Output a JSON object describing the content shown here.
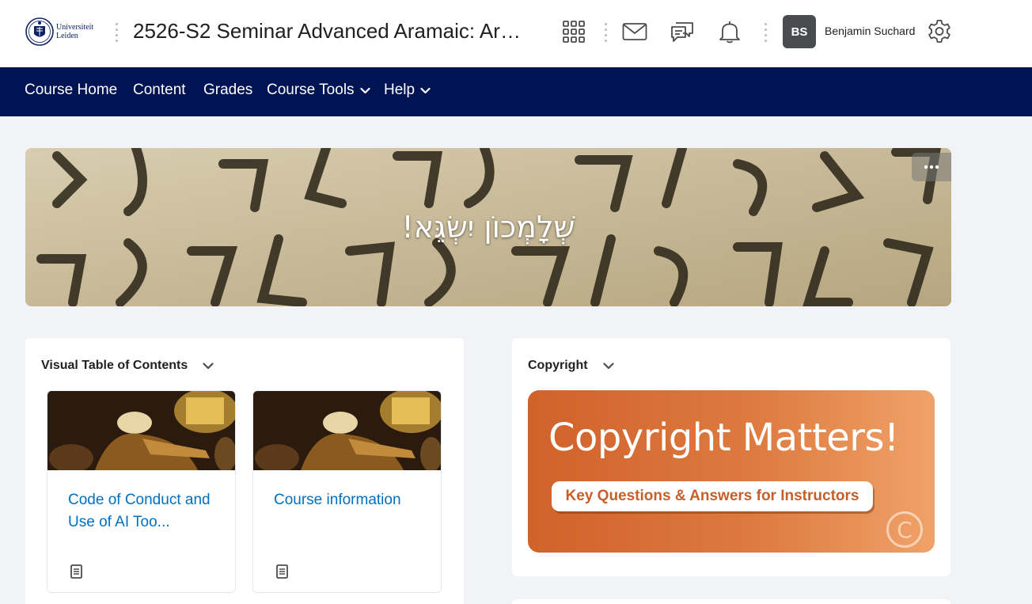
{
  "header": {
    "logo_text": [
      "Universiteit",
      "Leiden"
    ],
    "course_title": "2526-S2 Seminar Advanced Aramaic: Aram...",
    "icons": [
      "waffle-icon",
      "mail-icon",
      "chat-icon",
      "bell-icon",
      "gear-icon"
    ],
    "user": {
      "initials": "BS",
      "name": "Benjamin Suchard"
    }
  },
  "nav": {
    "items": [
      {
        "label": "Course Home",
        "dropdown": false
      },
      {
        "label": "Content",
        "dropdown": false
      },
      {
        "label": "Grades",
        "dropdown": false
      },
      {
        "label": "Course Tools",
        "dropdown": true
      },
      {
        "label": "Help",
        "dropdown": true
      }
    ]
  },
  "banner": {
    "title": "שְׁלָמְכוֹן יִשְׂגֵּא!",
    "menu_icon": "ellipsis-icon"
  },
  "toc_widget": {
    "heading": "Visual Table of Contents",
    "cards": [
      {
        "label": "Code of Conduct and Use of AI Too...",
        "icon": "document-icon"
      },
      {
        "label": "Course information",
        "icon": "document-icon"
      }
    ]
  },
  "copyright_widget": {
    "heading": "Copyright",
    "banner_title": "Copyright Matters!",
    "banner_subtitle": "Key Questions & Answers for Instructors",
    "banner_symbol": "C"
  },
  "colors": {
    "nav_bg": "#001353",
    "link": "#006fbf",
    "page_bg": "#f1f3f7",
    "avatar_bg": "#494c4e",
    "copyright_orange": "#d0622a"
  }
}
